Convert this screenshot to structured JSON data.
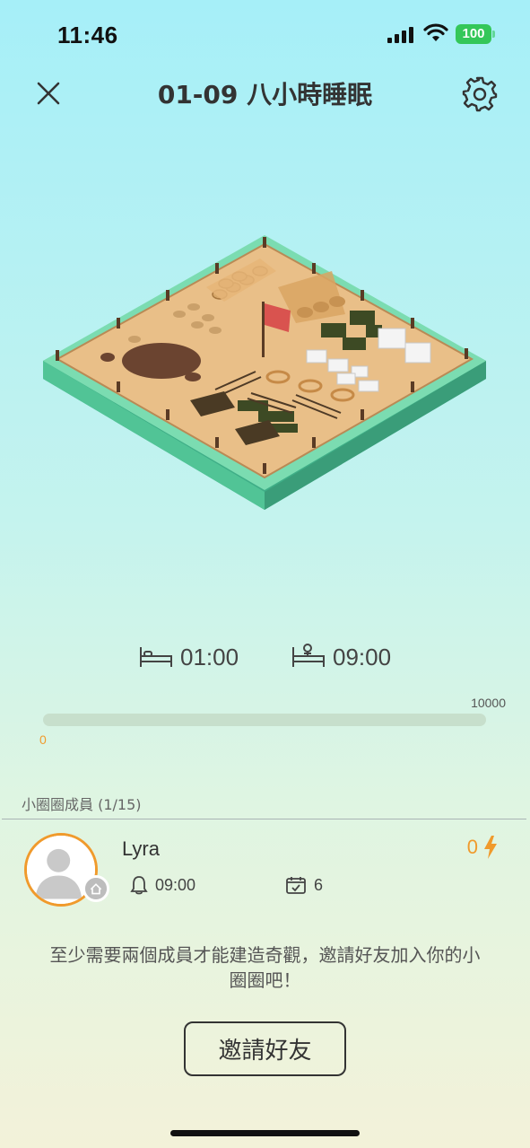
{
  "status_bar": {
    "time": "11:46",
    "battery": "100"
  },
  "header": {
    "title": "01-09 八小時睡眠",
    "close_icon": "close-icon",
    "settings_icon": "gear-icon"
  },
  "schedule": {
    "bedtime": "01:00",
    "wake_time": "09:00",
    "bed_icon": "bed-icon",
    "wake_icon": "wake-up-icon"
  },
  "progress": {
    "min_label": "0",
    "max_label": "10000",
    "fraction": 0
  },
  "members": {
    "header": "小圈圈成員 (1/15)",
    "items": [
      {
        "name": "Lyra",
        "energy": "0",
        "alarm_time": "09:00",
        "days": "6"
      }
    ]
  },
  "hint": "至少需要兩個成員才能建造奇觀，邀請好友加入你的小圈圈吧！",
  "invite_button": "邀請好友",
  "colors": {
    "accent": "#f09a2c",
    "battery": "#34c759"
  }
}
